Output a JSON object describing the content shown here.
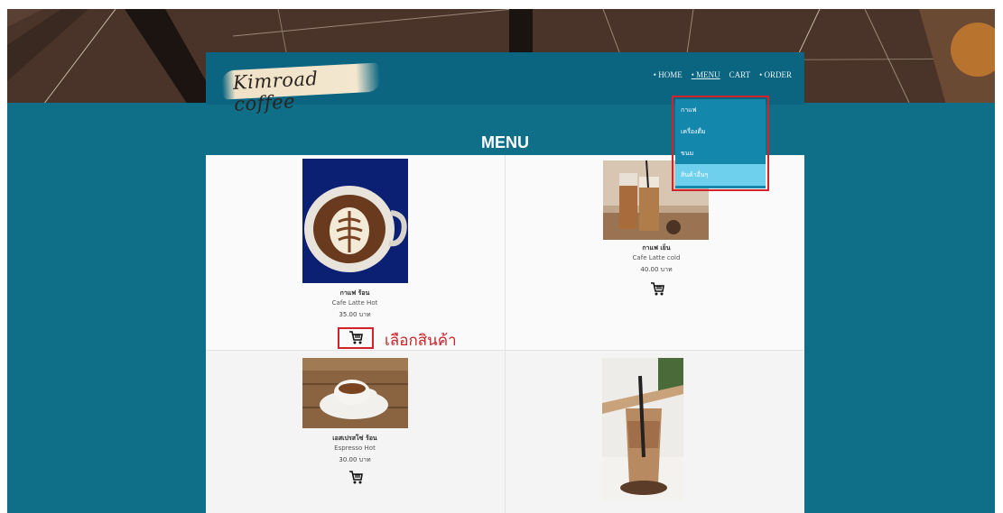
{
  "brand": {
    "logo_text": "Kimroad coffee"
  },
  "nav": [
    {
      "label": "HOME",
      "active": false
    },
    {
      "label": "MENU",
      "active": true
    },
    {
      "label": "CART",
      "active": false
    },
    {
      "label": "ORDER",
      "active": false
    }
  ],
  "dropdown": {
    "items": [
      "กาแฟ",
      "เครื่องดื่ม",
      "ขนม",
      "สินค้าอื่นๆ"
    ],
    "highlighted_index": 3
  },
  "page_title": "MENU",
  "products": [
    {
      "name_th": "กาแฟ ร้อน",
      "name_en": "Cafe Latte Hot",
      "price": "35.00 บาท",
      "image": "latte-art-cup"
    },
    {
      "name_th": "กาแฟ เย็น",
      "name_en": "Cafe Latte cold",
      "price": "40.00 บาท",
      "image": "iced-latte-glass"
    },
    {
      "name_th": "เอสเปรสโซ่ ร้อน",
      "name_en": "Espresso Hot",
      "price": "30.00 บาท",
      "image": "espresso-cup"
    },
    {
      "name_th": "",
      "name_en": "",
      "price": "",
      "image": "iced-coffee-tall"
    }
  ],
  "annotation": {
    "label": "เลือกสินค้า"
  },
  "colors": {
    "teal": "#0f6e88",
    "navbar": "#0b6580",
    "dropdown": "#1487ad",
    "highlight": "#6ed0ec",
    "annotation_red": "#d2232a"
  },
  "icons": {
    "cart": "cart-icon"
  }
}
